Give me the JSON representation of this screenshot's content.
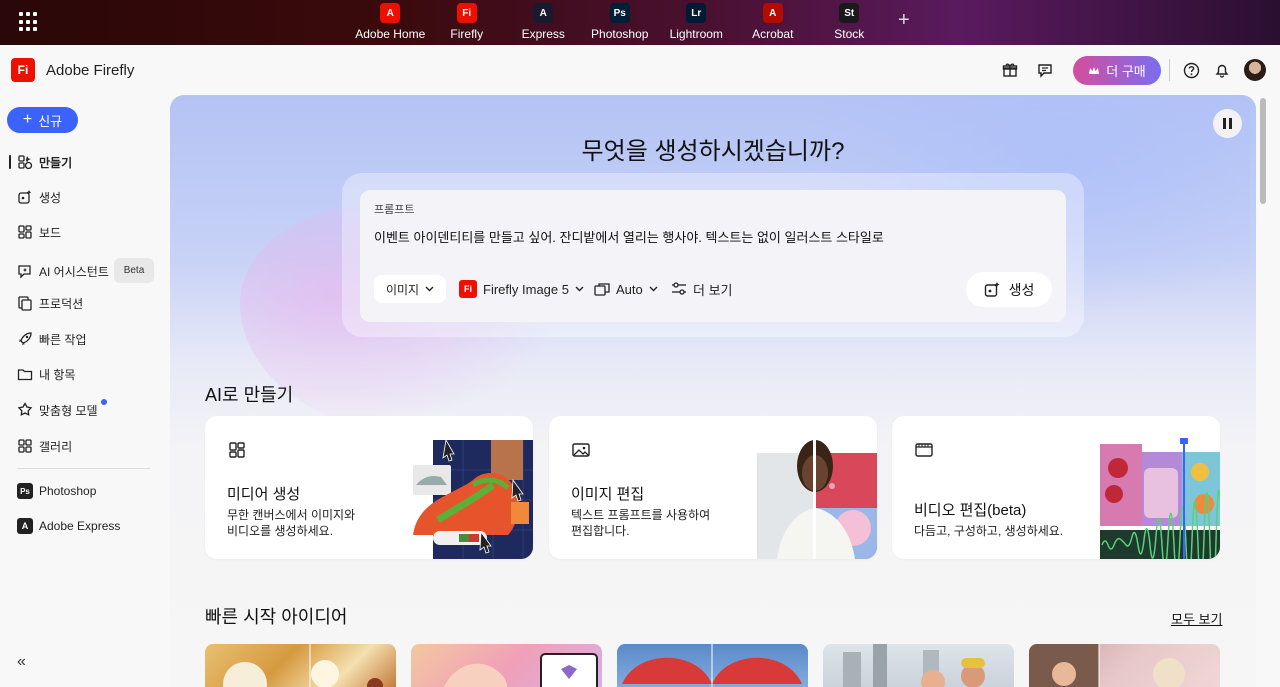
{
  "appbar": {
    "apps": [
      {
        "label": "Adobe Home",
        "icon": "A",
        "color": "#eb1000"
      },
      {
        "label": "Firefly",
        "icon": "Fi",
        "color": "#eb1000"
      },
      {
        "label": "Express",
        "icon": "A",
        "color": "#1a1a2e"
      },
      {
        "label": "Photoshop",
        "icon": "Ps",
        "color": "#001e36"
      },
      {
        "label": "Lightroom",
        "icon": "Lr",
        "color": "#001a33"
      },
      {
        "label": "Acrobat",
        "icon": "A",
        "color": "#b30b00"
      },
      {
        "label": "Stock",
        "icon": "St",
        "color": "#1a1a1a"
      }
    ],
    "add_label": "+"
  },
  "header": {
    "brand": "Adobe Firefly",
    "logo_text": "Fi",
    "buy_label": "더 구매",
    "accent": "#3b63fb"
  },
  "sidebar": {
    "new_label": "신규",
    "items": [
      {
        "label": "만들기",
        "icon": "create-icon"
      },
      {
        "label": "생성",
        "icon": "generate-icon"
      },
      {
        "label": "보드",
        "icon": "board-icon"
      },
      {
        "label": "AI 어시스턴트",
        "icon": "assistant-icon",
        "badge": "Beta"
      },
      {
        "label": "프로덕션",
        "icon": "production-icon"
      },
      {
        "label": "빠른 작업",
        "icon": "rocket-icon"
      },
      {
        "label": "내 항목",
        "icon": "folder-icon"
      },
      {
        "label": "맞춤형 모델",
        "icon": "custom-model-icon"
      },
      {
        "label": "갤러리",
        "icon": "gallery-icon"
      }
    ],
    "apps": [
      {
        "label": "Photoshop",
        "icon": "Ps"
      },
      {
        "label": "Adobe Express",
        "icon": "A"
      }
    ]
  },
  "hero": {
    "title": "무엇을 생성하시겠습니까?",
    "prompt_label": "프롬프트",
    "prompt_text": "이벤트 아이덴티티를 만들고 싶어. 잔디밭에서 열리는 행사야. 텍스트는 없이 일러스트 스타일로",
    "type_label": "이미지",
    "model_label": "Firefly Image 5",
    "aspect_label": "Auto",
    "more_label": "더 보기",
    "generate_label": "생성"
  },
  "ai_section": {
    "title": "AI로 만들기",
    "cards": [
      {
        "title": "미디어 생성",
        "desc1": "무한 캔버스에서 이미지와",
        "desc2": "비디오를 생성하세요."
      },
      {
        "title": "이미지 편집",
        "desc1": "텍스트 프롬프트를 사용하여",
        "desc2": "편집합니다."
      },
      {
        "title": "비디오 편집(beta)",
        "desc1": "다듬고, 구성하고, 생성하세요.",
        "desc2": ""
      }
    ]
  },
  "quick_section": {
    "title": "빠른 시작 아이디어",
    "see_all": "모두 보기"
  }
}
